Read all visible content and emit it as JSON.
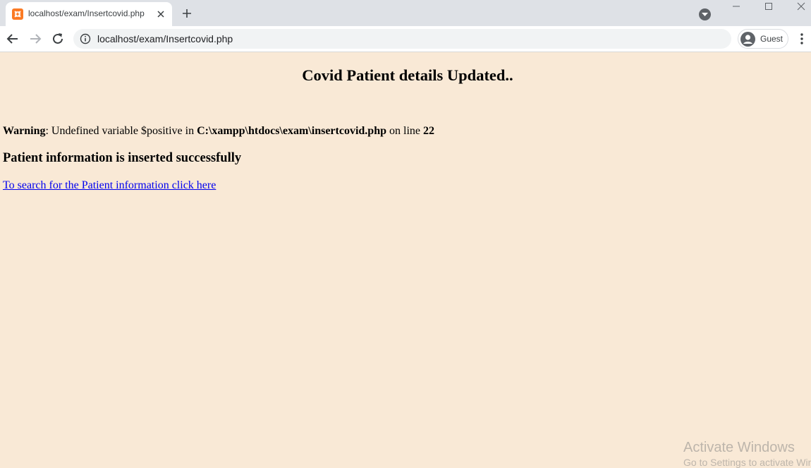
{
  "browser": {
    "tab": {
      "title": "localhost/exam/Insertcovid.php"
    },
    "url": "localhost/exam/Insertcovid.php",
    "profile": "Guest",
    "icons": [
      "xampp-favicon",
      "close-icon",
      "plus-icon",
      "tab-search-icon",
      "minimize-icon",
      "maximize-icon",
      "window-close-icon",
      "back-icon",
      "forward-icon",
      "reload-icon",
      "info-icon",
      "avatar-icon",
      "kebab-menu-icon"
    ]
  },
  "page": {
    "title": "Covid Patient details Updated..",
    "warning": {
      "label": "Warning",
      "message_1": ": Undefined variable $positive in ",
      "path": "C:\\xampp\\htdocs\\exam\\insertcovid.php",
      "message_2": " on line ",
      "line": "22"
    },
    "success_message": "Patient information is inserted successfully",
    "search_link": "To search for the Patient information click here"
  },
  "watermark": {
    "title": "Activate Windows",
    "subtitle": "Go to Settings to activate Windows."
  },
  "colors": {
    "page_background": "#f9e9d6",
    "link": "#0000ee",
    "favicon": "#fb7a24"
  }
}
